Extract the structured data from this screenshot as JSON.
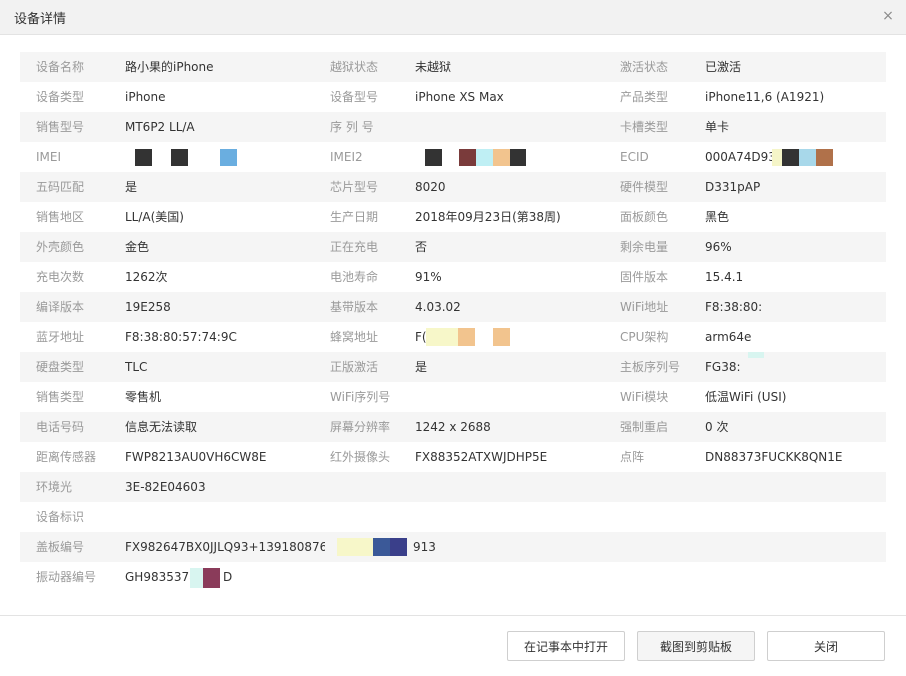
{
  "dialog": {
    "title": "设备详情",
    "close_glyph": "×",
    "close_icon": "close-icon"
  },
  "rows": [
    [
      {
        "label": "设备名称",
        "value": "路小果的iPhone"
      },
      {
        "label": "越狱状态",
        "value": "未越狱"
      },
      {
        "label": "激活状态",
        "value": "已激活"
      }
    ],
    [
      {
        "label": "设备类型",
        "value": "iPhone"
      },
      {
        "label": "设备型号",
        "value": "iPhone XS Max"
      },
      {
        "label": "产品类型",
        "value": "iPhone11,6 (A1921)"
      }
    ],
    [
      {
        "label": "销售型号",
        "value": "MT6P2 LL/A"
      },
      {
        "label": "序 列 号",
        "value": ""
      },
      {
        "label": "卡槽类型",
        "value": "单卡"
      }
    ],
    [
      {
        "label": "IMEI",
        "value": ""
      },
      {
        "label": "IMEI2",
        "value": ""
      },
      {
        "label": "ECID",
        "value": "000A74D93"
      }
    ],
    [
      {
        "label": "五码匹配",
        "value": "是"
      },
      {
        "label": "芯片型号",
        "value": "8020"
      },
      {
        "label": "硬件模型",
        "value": "D331pAP"
      }
    ],
    [
      {
        "label": "销售地区",
        "value": "LL/A(美国)"
      },
      {
        "label": "生产日期",
        "value": "2018年09月23日(第38周)"
      },
      {
        "label": "面板颜色",
        "value": "黑色"
      }
    ],
    [
      {
        "label": "外壳颜色",
        "value": "金色"
      },
      {
        "label": "正在充电",
        "value": "否"
      },
      {
        "label": "剩余电量",
        "value": "96%"
      }
    ],
    [
      {
        "label": "充电次数",
        "value": "1262次"
      },
      {
        "label": "电池寿命",
        "value": "91%"
      },
      {
        "label": "固件版本",
        "value": "15.4.1"
      }
    ],
    [
      {
        "label": "编译版本",
        "value": "19E258"
      },
      {
        "label": "基带版本",
        "value": "4.03.02"
      },
      {
        "label": "WiFi地址",
        "value": "F8:38:80:"
      }
    ],
    [
      {
        "label": "蓝牙地址",
        "value": "F8:38:80:57:74:9C"
      },
      {
        "label": "蜂窝地址",
        "value": "F("
      },
      {
        "label": "CPU架构",
        "value": "arm64e"
      }
    ],
    [
      {
        "label": "硬盘类型",
        "value": "TLC"
      },
      {
        "label": "正版激活",
        "value": "是"
      },
      {
        "label": "主板序列号",
        "value": "FG38:"
      }
    ],
    [
      {
        "label": "销售类型",
        "value": "零售机"
      },
      {
        "label": "WiFi序列号",
        "value": ""
      },
      {
        "label": "WiFi模块",
        "value": "低温WiFi (USI)"
      }
    ],
    [
      {
        "label": "电话号码",
        "value": "信息无法读取"
      },
      {
        "label": "屏幕分辨率",
        "value": "1242 x 2688"
      },
      {
        "label": "强制重启",
        "value": "0 次"
      }
    ],
    [
      {
        "label": "距离传感器",
        "value": "FWP8213AU0VH6CW8E"
      },
      {
        "label": "红外摄像头",
        "value": "FX88352ATXWJDHP5E"
      },
      {
        "label": "点阵",
        "value": "DN88373FUCKK8QN1E"
      }
    ],
    [
      {
        "label": "环境光",
        "value": "3E-82E04603"
      }
    ],
    [
      {
        "label": "设备标识",
        "value": ""
      }
    ],
    [
      {
        "label": "盖板编号",
        "value": "FX982647BX0JJLQ93+13918087699"
      }
    ],
    [
      {
        "label": "振动器编号",
        "value": "GH98353787"
      }
    ]
  ],
  "cover_suffix": "913",
  "vibrator_suffix": "D",
  "buttons": {
    "open_notepad": "在记事本中打开",
    "screenshot_clipboard": "截图到剪贴板",
    "close": "关闭"
  },
  "colors": {
    "title_bg": "#f2f2f2",
    "row_alt_bg": "#f5f5f5",
    "label": "#9a9a9a",
    "value": "#333333"
  }
}
